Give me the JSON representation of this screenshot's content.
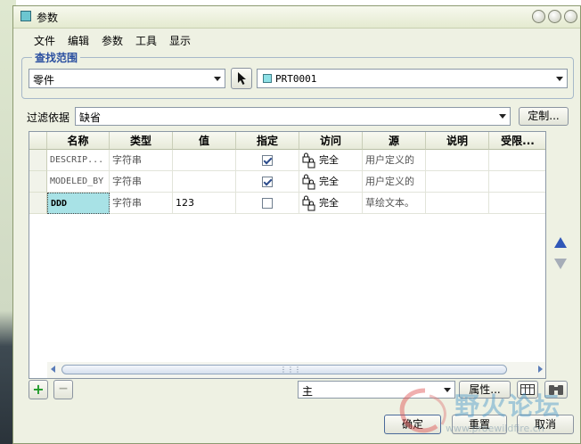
{
  "window": {
    "title": "参数"
  },
  "menu": [
    "文件",
    "编辑",
    "参数",
    "工具",
    "显示"
  ],
  "scope": {
    "label": "查找范围",
    "type_value": "零件",
    "object_value": "PRT0001"
  },
  "filter": {
    "label": "过滤依据",
    "value": "缺省",
    "customize_label": "定制..."
  },
  "table": {
    "columns": [
      "名称",
      "类型",
      "值",
      "指定",
      "访问",
      "源",
      "说明",
      "受限..."
    ],
    "rows": [
      {
        "name": "DESCRIP...",
        "type": "字符串",
        "value": "",
        "designated": true,
        "access": "完全",
        "source": "用户定义的"
      },
      {
        "name": "MODELED_BY",
        "type": "字符串",
        "value": "",
        "designated": true,
        "access": "完全",
        "source": "用户定义的"
      },
      {
        "name": "DDD",
        "type": "字符串",
        "value": "123",
        "designated": false,
        "access": "完全",
        "source": "草绘文本。"
      }
    ]
  },
  "bottom": {
    "add_symbol": "+",
    "remove_symbol": "−",
    "set_value": "主",
    "properties_label": "属性...",
    "ok_label": "确定",
    "reset_label": "重置",
    "cancel_label": "取消"
  },
  "watermark": {
    "text": "野火论坛",
    "url": "www.proewildfire.cn"
  }
}
